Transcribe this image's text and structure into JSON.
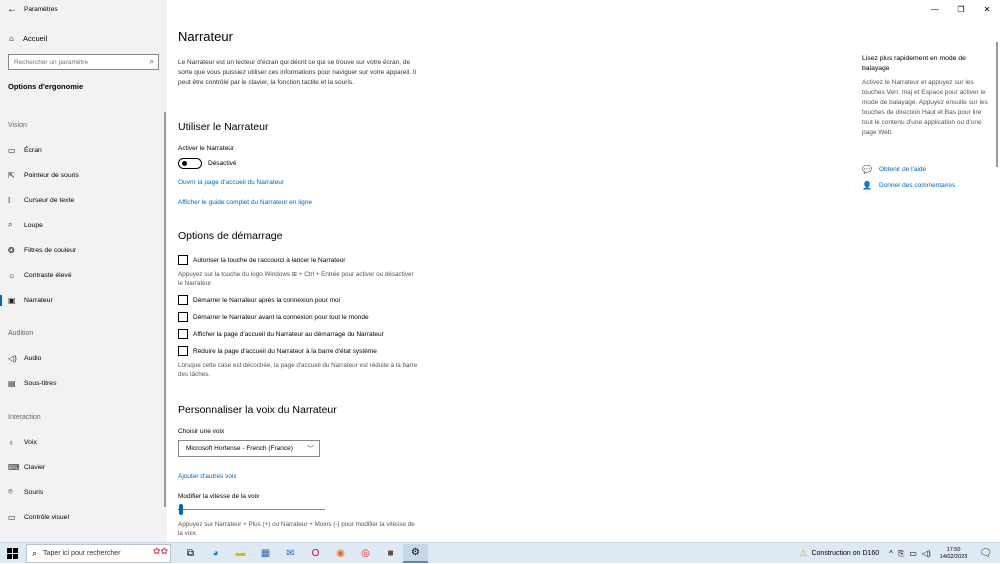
{
  "window": {
    "app_title": "Paramètres",
    "back_icon": "←",
    "controls": [
      "—",
      "❐",
      "✕"
    ]
  },
  "sidebar": {
    "home": "Accueil",
    "search_placeholder": "Rechercher un paramètre",
    "section_title": "Options d'ergonomie",
    "groups": {
      "vision": "Vision",
      "audition": "Audition",
      "interaction": "Interaction"
    },
    "items": [
      {
        "label": "Écran",
        "icon": "▭"
      },
      {
        "label": "Pointeur de souris",
        "icon": "⇱"
      },
      {
        "label": "Curseur de texte",
        "icon": "I"
      },
      {
        "label": "Loupe",
        "icon": "⌕"
      },
      {
        "label": "Filtres de couleur",
        "icon": "❂"
      },
      {
        "label": "Contraste élevé",
        "icon": "☼"
      },
      {
        "label": "Narrateur",
        "icon": "▣"
      },
      {
        "label": "Audio",
        "icon": "◁)"
      },
      {
        "label": "Sous-titres",
        "icon": "▤"
      },
      {
        "label": "Voix",
        "icon": "♁"
      },
      {
        "label": "Clavier",
        "icon": "⌨"
      },
      {
        "label": "Souris",
        "icon": "⌾"
      },
      {
        "label": "Contrôle visuel",
        "icon": "▭"
      }
    ],
    "active_item": "Narrateur"
  },
  "main": {
    "title": "Narrateur",
    "description": "Le Narrateur est un lecteur d'écran qui décrit ce qui se trouve sur votre écran, de sorte que vous puissiez utiliser ces informations pour naviguer sur votre appareil. Il peut être contrôlé par le clavier, la fonction tactile et la souris.",
    "use_section": {
      "heading": "Utiliser le Narrateur",
      "toggle_label": "Activer le Narrateur",
      "toggle_state": "Désactivé",
      "toggle_on": false,
      "link_home": "Ouvrir la page d'accueil du Narrateur",
      "link_guide": "Afficher le guide complet du Narrateur en ligne"
    },
    "startup_section": {
      "heading": "Options de démarrage",
      "checkbox_shortcut": "Autoriser la touche de raccourci à lancer le Narrateur",
      "shortcut_hint": "Appuyez sur la touche du logo Windows ⊞ + Ctrl + Entrée pour activer ou désactiver le Narrateur.",
      "checkbox_after_login": "Démarrer le Narrateur après la connexion pour moi",
      "checkbox_before_login": "Démarrer le Narrateur avant la connexion pour tout le monde",
      "checkbox_show_home": "Afficher la page d'accueil du Narrateur au démarrage du Narrateur",
      "checkbox_minimize_home": "Réduire la page d'accueil du Narrateur à la barre d'état système",
      "minimize_hint": "Lorsque cette case est décochée, la page d'accueil du Narrateur est réduite à la barre des tâches."
    },
    "voice_section": {
      "heading": "Personnaliser la voix du Narrateur",
      "choose_voice_label": "Choisir une voix",
      "selected_voice": "Microsoft Hortense - French (France)",
      "add_voices_link": "Ajouter d'autres voix",
      "speed_label": "Modifier la vitesse de la voix",
      "speed_value": 0.0,
      "speed_hint": "Appuyez sur Narrateur + Plus (+) ou Narrateur + Moins (-) pour modifier la vitesse de la voix."
    }
  },
  "right_panel": {
    "title": "Lisez plus rapidement en mode de balayage",
    "text": "Activez le Narrateur et appuyez sur les touches Verr. maj et Espace pour activer le mode de balayage. Appuyez ensuite sur les touches de direction Haut et Bas pour lire tout le contenu d'une application ou d'une page Web.",
    "help_link": "Obtenir de l'aide",
    "feedback_link": "Donner des commentaires"
  },
  "taskbar": {
    "search_placeholder": "Taper ici pour rechercher",
    "weather": "Construction on D160",
    "time": "17:50",
    "date": "14/02/2023",
    "accent_color": "#0067c0"
  }
}
